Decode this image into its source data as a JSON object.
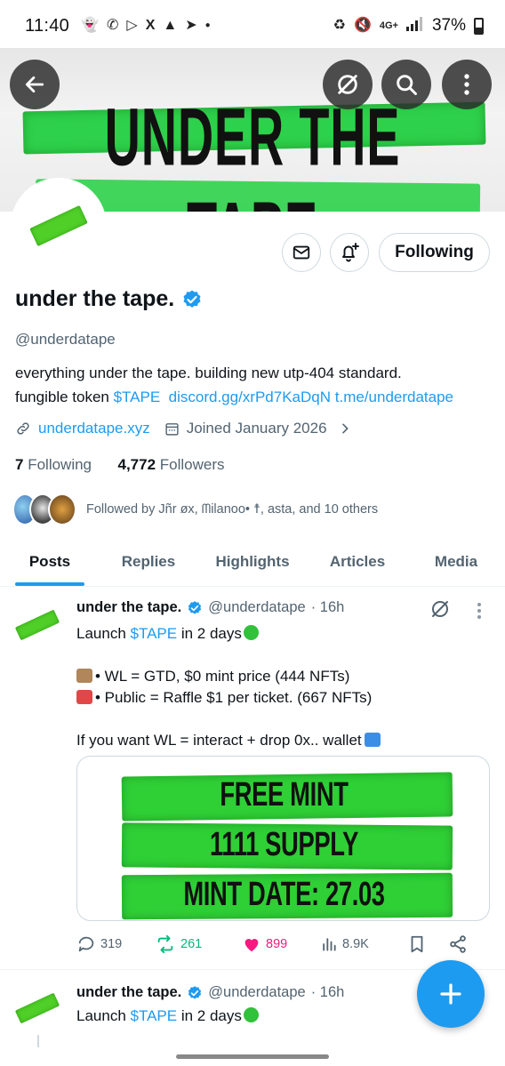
{
  "status_bar": {
    "time": "11:40",
    "battery": "37%",
    "network": "4G+",
    "left_icons": [
      "snapchat-icon",
      "whatsapp-icon",
      "media-icon",
      "x-icon",
      "warning-icon",
      "telegram-icon",
      "dot-icon"
    ],
    "right_icons": [
      "recycle-icon",
      "mute-icon",
      "network-icon",
      "signal-icon",
      "battery-icon"
    ]
  },
  "banner": {
    "text": "UNDER THE TAPE",
    "accent": "#2ed14b"
  },
  "header_buttons": [
    "back-arrow-icon",
    "grok-icon",
    "search-icon",
    "more-vertical-icon"
  ],
  "profile": {
    "name": "under the tape.",
    "handle": "@underdatape",
    "bio_line1": "everything under the tape.  building new utp-404 standard.",
    "bio_prefix": "fungible token ",
    "bio_cashtag": "$TAPE",
    "bio_link1": "discord.gg/xrPd7KaDqN",
    "bio_link2": "t.me/underdatape",
    "website": "underdatape.xyz",
    "joined": "Joined January 2026",
    "following_count": "7",
    "following_label": "Following",
    "followers_count": "4,772",
    "followers_label": "Followers",
    "followed_by": "Followed by Jñr øx, ᗰilanoo• ☨, asta, and 10 others",
    "follow_button": "Following"
  },
  "tabs": [
    "Posts",
    "Replies",
    "Highlights",
    "Articles",
    "Media"
  ],
  "tweets": [
    {
      "name": "under the tape.",
      "handle": "@underdatape",
      "time": "· 16h",
      "line1_a": "Launch ",
      "line1_cash": "$TAPE",
      "line1_b": " in 2 days",
      "line2": "• WL = GTD, $0 mint price (444 NFTs)",
      "line3": "• Public = Raffle $1 per ticket. (667 NFTs)",
      "line4": "If you want WL = interact + drop 0x.. wallet",
      "media_lines": [
        "FREE MINT",
        "1111 SUPPLY",
        "MINT DATE: 27.03"
      ],
      "replies": "319",
      "reposts": "261",
      "likes": "899",
      "views": "8.9K"
    },
    {
      "name": "under the tape.",
      "handle": "@underdatape",
      "time": "· 16h",
      "line1_a": "Launch ",
      "line1_cash": "$TAPE",
      "line1_b": " in 2 days"
    }
  ],
  "colors": {
    "accent_blue": "#1d9bf0",
    "repost_green": "#00ba7c",
    "like_pink": "#f91880",
    "tape_green": "#2fcf36"
  }
}
